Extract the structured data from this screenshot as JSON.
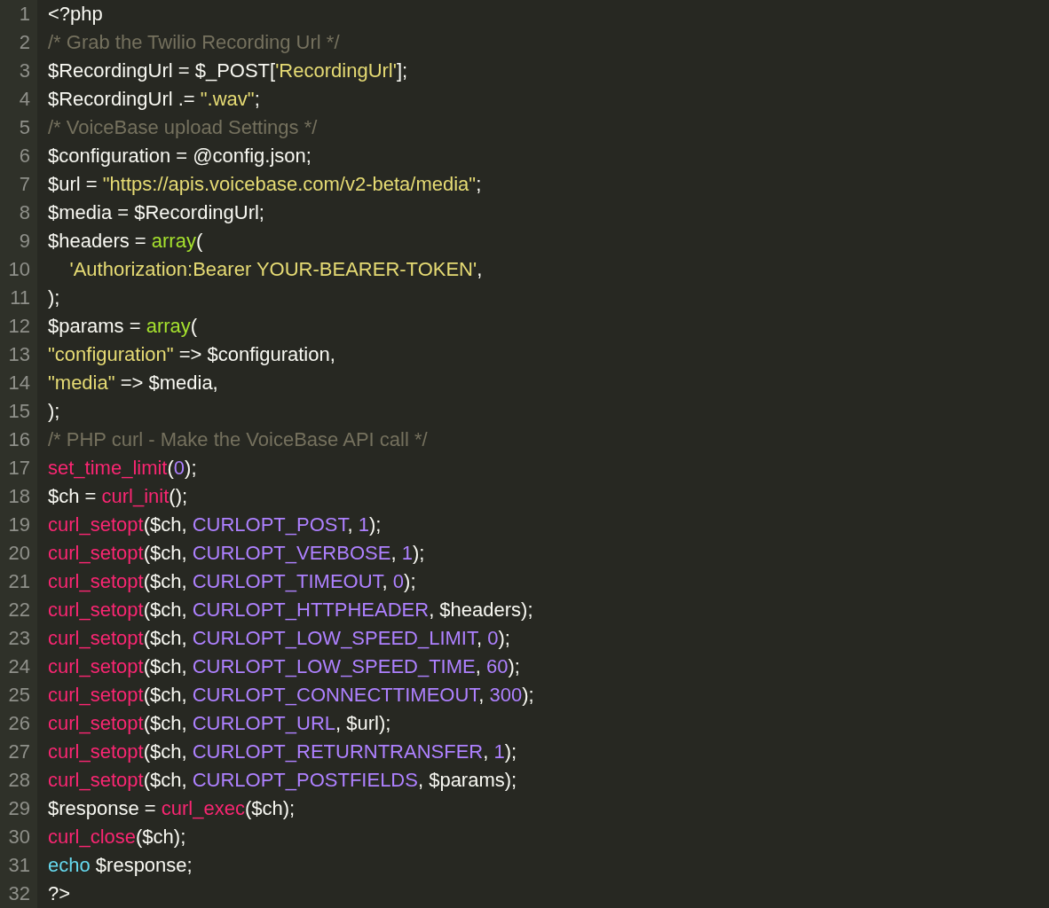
{
  "editor": {
    "lines": [
      {
        "number": "1",
        "tokens": [
          {
            "kind": "plain",
            "text": "<?php"
          }
        ]
      },
      {
        "number": "2",
        "tokens": [
          {
            "kind": "comment",
            "text": "/* Grab the Twilio Recording Url */"
          }
        ]
      },
      {
        "number": "3",
        "tokens": [
          {
            "kind": "plain",
            "text": "$RecordingUrl = $_POST["
          },
          {
            "kind": "string",
            "text": "'RecordingUrl'"
          },
          {
            "kind": "plain",
            "text": "];"
          }
        ]
      },
      {
        "number": "4",
        "tokens": [
          {
            "kind": "plain",
            "text": "$RecordingUrl .= "
          },
          {
            "kind": "string",
            "text": "\".wav\""
          },
          {
            "kind": "plain",
            "text": ";"
          }
        ]
      },
      {
        "number": "5",
        "tokens": [
          {
            "kind": "comment",
            "text": "/* VoiceBase upload Settings */"
          }
        ]
      },
      {
        "number": "6",
        "tokens": [
          {
            "kind": "plain",
            "text": "$configuration = @config.json;"
          }
        ]
      },
      {
        "number": "7",
        "tokens": [
          {
            "kind": "plain",
            "text": "$url = "
          },
          {
            "kind": "string",
            "text": "\"https://apis.voicebase.com/v2-beta/media\""
          },
          {
            "kind": "plain",
            "text": ";"
          }
        ]
      },
      {
        "number": "8",
        "tokens": [
          {
            "kind": "plain",
            "text": "$media = $RecordingUrl;"
          }
        ]
      },
      {
        "number": "9",
        "tokens": [
          {
            "kind": "plain",
            "text": "$headers = "
          },
          {
            "kind": "builtin",
            "text": "array"
          },
          {
            "kind": "plain",
            "text": "("
          }
        ]
      },
      {
        "number": "10",
        "tokens": [
          {
            "kind": "string",
            "text": "    'Authorization:Bearer YOUR-BEARER-TOKEN'"
          },
          {
            "kind": "plain",
            "text": ","
          }
        ]
      },
      {
        "number": "11",
        "tokens": [
          {
            "kind": "plain",
            "text": ");"
          }
        ]
      },
      {
        "number": "12",
        "tokens": [
          {
            "kind": "plain",
            "text": "$params = "
          },
          {
            "kind": "builtin",
            "text": "array"
          },
          {
            "kind": "plain",
            "text": "("
          }
        ]
      },
      {
        "number": "13",
        "tokens": [
          {
            "kind": "string",
            "text": "\"configuration\""
          },
          {
            "kind": "plain",
            "text": " => $configuration,"
          }
        ]
      },
      {
        "number": "14",
        "tokens": [
          {
            "kind": "string",
            "text": "\"media\""
          },
          {
            "kind": "plain",
            "text": " => $media,"
          }
        ]
      },
      {
        "number": "15",
        "tokens": [
          {
            "kind": "plain",
            "text": ");"
          }
        ]
      },
      {
        "number": "16",
        "tokens": [
          {
            "kind": "comment",
            "text": "/* PHP curl - Make the VoiceBase API call */"
          }
        ]
      },
      {
        "number": "17",
        "tokens": [
          {
            "kind": "function",
            "text": "set_time_limit"
          },
          {
            "kind": "plain",
            "text": "("
          },
          {
            "kind": "constant",
            "text": "0"
          },
          {
            "kind": "plain",
            "text": ");"
          }
        ]
      },
      {
        "number": "18",
        "tokens": [
          {
            "kind": "plain",
            "text": "$ch = "
          },
          {
            "kind": "function",
            "text": "curl_init"
          },
          {
            "kind": "plain",
            "text": "();"
          }
        ]
      },
      {
        "number": "19",
        "tokens": [
          {
            "kind": "function",
            "text": "curl_setopt"
          },
          {
            "kind": "plain",
            "text": "($ch, "
          },
          {
            "kind": "constant",
            "text": "CURLOPT_POST"
          },
          {
            "kind": "plain",
            "text": ", "
          },
          {
            "kind": "constant",
            "text": "1"
          },
          {
            "kind": "plain",
            "text": ");"
          }
        ]
      },
      {
        "number": "20",
        "tokens": [
          {
            "kind": "function",
            "text": "curl_setopt"
          },
          {
            "kind": "plain",
            "text": "($ch, "
          },
          {
            "kind": "constant",
            "text": "CURLOPT_VERBOSE"
          },
          {
            "kind": "plain",
            "text": ", "
          },
          {
            "kind": "constant",
            "text": "1"
          },
          {
            "kind": "plain",
            "text": ");"
          }
        ]
      },
      {
        "number": "21",
        "tokens": [
          {
            "kind": "function",
            "text": "curl_setopt"
          },
          {
            "kind": "plain",
            "text": "($ch, "
          },
          {
            "kind": "constant",
            "text": "CURLOPT_TIMEOUT"
          },
          {
            "kind": "plain",
            "text": ", "
          },
          {
            "kind": "constant",
            "text": "0"
          },
          {
            "kind": "plain",
            "text": ");"
          }
        ]
      },
      {
        "number": "22",
        "tokens": [
          {
            "kind": "function",
            "text": "curl_setopt"
          },
          {
            "kind": "plain",
            "text": "($ch, "
          },
          {
            "kind": "constant",
            "text": "CURLOPT_HTTPHEADER"
          },
          {
            "kind": "plain",
            "text": ", $headers);"
          }
        ]
      },
      {
        "number": "23",
        "tokens": [
          {
            "kind": "function",
            "text": "curl_setopt"
          },
          {
            "kind": "plain",
            "text": "($ch, "
          },
          {
            "kind": "constant",
            "text": "CURLOPT_LOW_SPEED_LIMIT"
          },
          {
            "kind": "plain",
            "text": ", "
          },
          {
            "kind": "constant",
            "text": "0"
          },
          {
            "kind": "plain",
            "text": ");"
          }
        ]
      },
      {
        "number": "24",
        "tokens": [
          {
            "kind": "function",
            "text": "curl_setopt"
          },
          {
            "kind": "plain",
            "text": "($ch, "
          },
          {
            "kind": "constant",
            "text": "CURLOPT_LOW_SPEED_TIME"
          },
          {
            "kind": "plain",
            "text": ", "
          },
          {
            "kind": "constant",
            "text": "60"
          },
          {
            "kind": "plain",
            "text": ");"
          }
        ]
      },
      {
        "number": "25",
        "tokens": [
          {
            "kind": "function",
            "text": "curl_setopt"
          },
          {
            "kind": "plain",
            "text": "($ch, "
          },
          {
            "kind": "constant",
            "text": "CURLOPT_CONNECTTIMEOUT"
          },
          {
            "kind": "plain",
            "text": ", "
          },
          {
            "kind": "constant",
            "text": "300"
          },
          {
            "kind": "plain",
            "text": ");"
          }
        ]
      },
      {
        "number": "26",
        "tokens": [
          {
            "kind": "function",
            "text": "curl_setopt"
          },
          {
            "kind": "plain",
            "text": "($ch, "
          },
          {
            "kind": "constant",
            "text": "CURLOPT_URL"
          },
          {
            "kind": "plain",
            "text": ", $url);"
          }
        ]
      },
      {
        "number": "27",
        "tokens": [
          {
            "kind": "function",
            "text": "curl_setopt"
          },
          {
            "kind": "plain",
            "text": "($ch, "
          },
          {
            "kind": "constant",
            "text": "CURLOPT_RETURNTRANSFER"
          },
          {
            "kind": "plain",
            "text": ", "
          },
          {
            "kind": "constant",
            "text": "1"
          },
          {
            "kind": "plain",
            "text": ");"
          }
        ]
      },
      {
        "number": "28",
        "tokens": [
          {
            "kind": "function",
            "text": "curl_setopt"
          },
          {
            "kind": "plain",
            "text": "($ch, "
          },
          {
            "kind": "constant",
            "text": "CURLOPT_POSTFIELDS"
          },
          {
            "kind": "plain",
            "text": ", $params);"
          }
        ]
      },
      {
        "number": "29",
        "tokens": [
          {
            "kind": "plain",
            "text": "$response = "
          },
          {
            "kind": "function",
            "text": "curl_exec"
          },
          {
            "kind": "plain",
            "text": "($ch);"
          }
        ]
      },
      {
        "number": "30",
        "tokens": [
          {
            "kind": "function",
            "text": "curl_close"
          },
          {
            "kind": "plain",
            "text": "($ch);"
          }
        ]
      },
      {
        "number": "31",
        "tokens": [
          {
            "kind": "keyword",
            "text": "echo"
          },
          {
            "kind": "plain",
            "text": " $response;"
          }
        ]
      },
      {
        "number": "32",
        "tokens": [
          {
            "kind": "plain",
            "text": "?>"
          }
        ]
      }
    ]
  }
}
